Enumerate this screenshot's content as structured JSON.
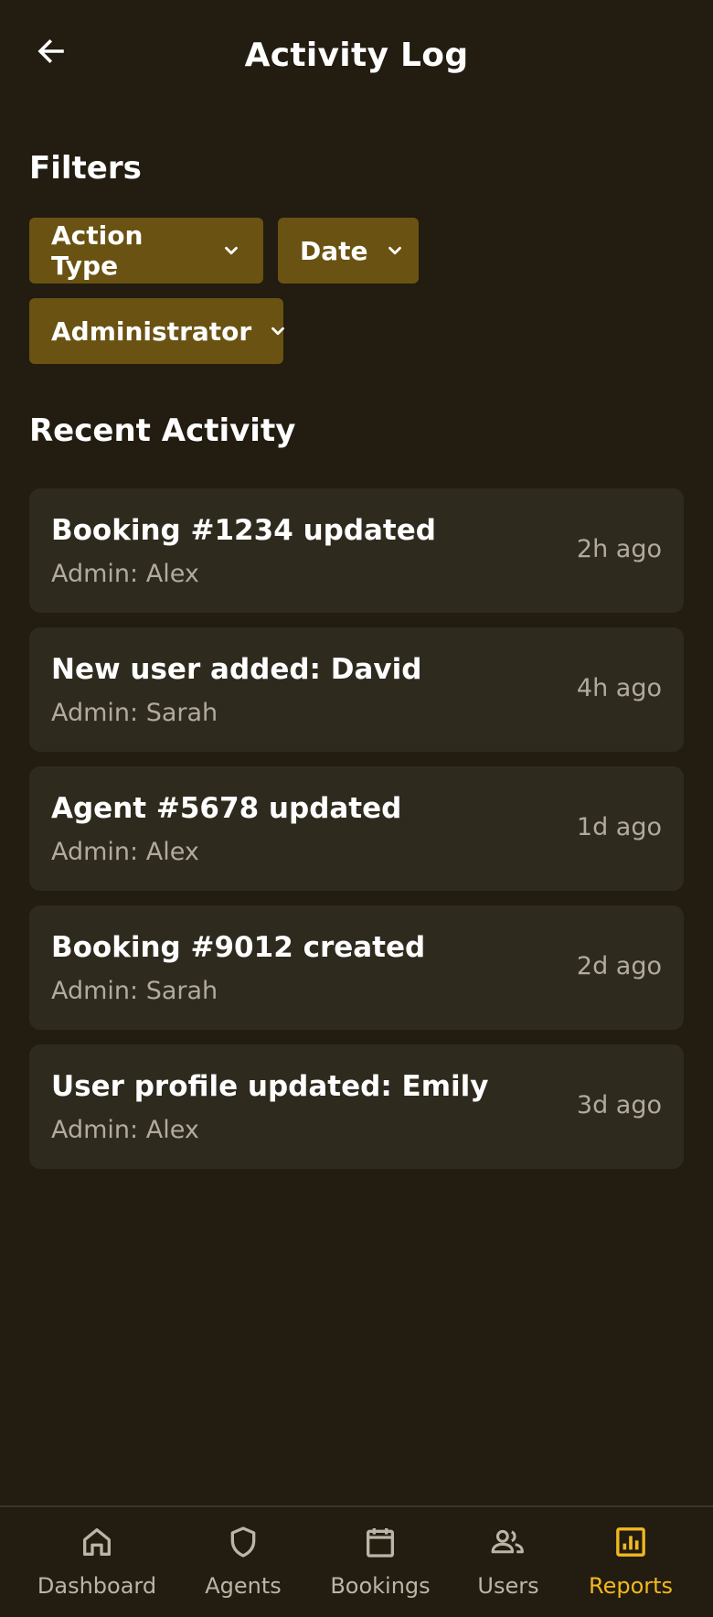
{
  "header": {
    "title": "Activity Log",
    "back_icon": "arrow-left-icon"
  },
  "filters": {
    "title": "Filters",
    "chips": [
      {
        "label": "Action Type",
        "icon": "chevron-down-icon"
      },
      {
        "label": "Date",
        "icon": "chevron-down-icon"
      },
      {
        "label": "Administrator",
        "icon": "chevron-down-icon"
      }
    ]
  },
  "recent": {
    "title": "Recent Activity",
    "items": [
      {
        "title": "Booking #1234 updated",
        "admin": "Admin: Alex",
        "time": "2h ago"
      },
      {
        "title": "New user added: David",
        "admin": "Admin: Sarah",
        "time": "4h ago"
      },
      {
        "title": "Agent #5678 updated",
        "admin": "Admin: Alex",
        "time": "1d ago"
      },
      {
        "title": "Booking #9012 created",
        "admin": "Admin: Sarah",
        "time": "2d ago"
      },
      {
        "title": "User profile updated: Emily",
        "admin": "Admin: Alex",
        "time": "3d ago"
      }
    ]
  },
  "nav": {
    "items": [
      {
        "label": "Dashboard",
        "icon": "home-icon",
        "active": false
      },
      {
        "label": "Agents",
        "icon": "shield-icon",
        "active": false
      },
      {
        "label": "Bookings",
        "icon": "calendar-icon",
        "active": false
      },
      {
        "label": "Users",
        "icon": "users-icon",
        "active": false
      },
      {
        "label": "Reports",
        "icon": "bar-chart-icon",
        "active": true
      }
    ]
  },
  "colors": {
    "background": "#221c11",
    "chip": "#6a5212",
    "card": "#2f2a1e",
    "accent": "#f2b91f",
    "muted_text": "#b2ab9d"
  }
}
